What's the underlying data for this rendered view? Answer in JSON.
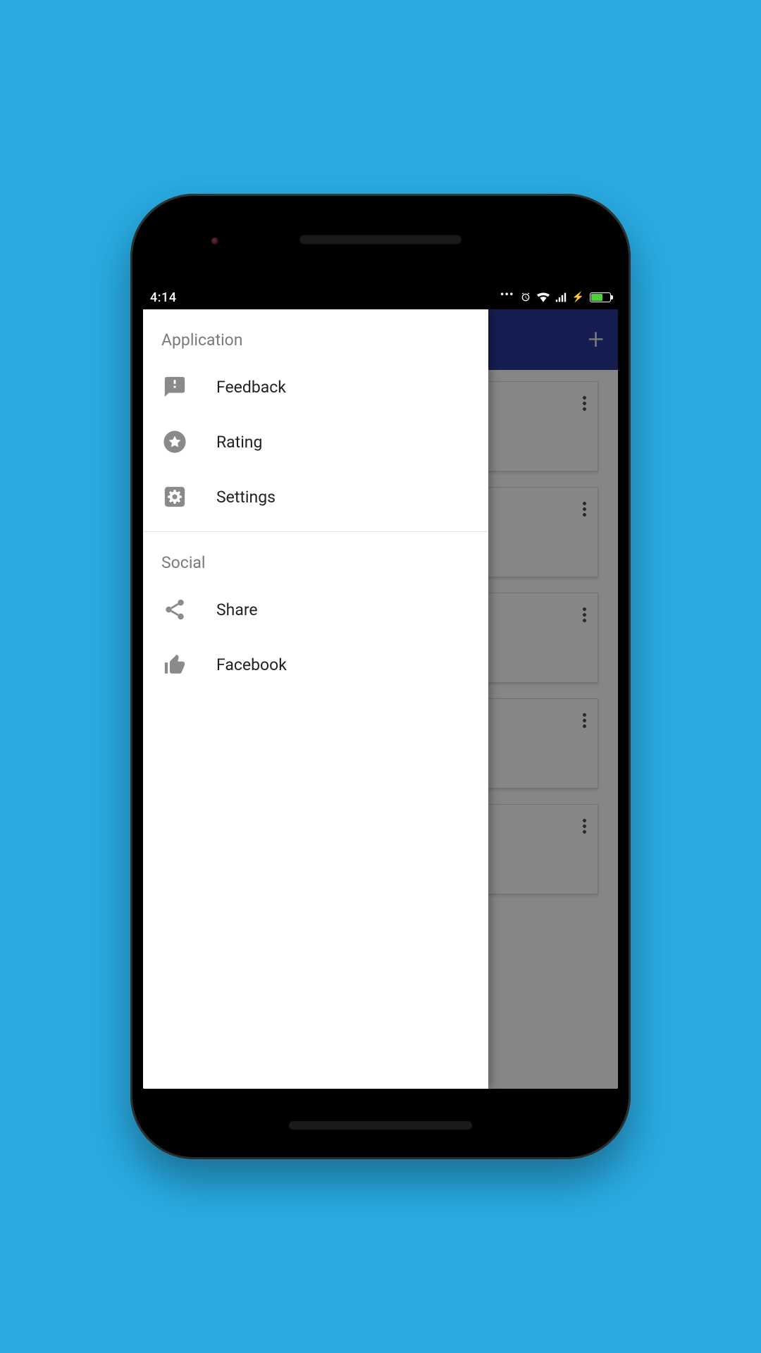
{
  "status": {
    "time": "4:14"
  },
  "drawer": {
    "sections": [
      {
        "title": "Application",
        "items": [
          {
            "label": "Feedback"
          },
          {
            "label": "Rating"
          },
          {
            "label": "Settings"
          }
        ]
      },
      {
        "title": "Social",
        "items": [
          {
            "label": "Share"
          },
          {
            "label": "Facebook"
          }
        ]
      }
    ]
  }
}
